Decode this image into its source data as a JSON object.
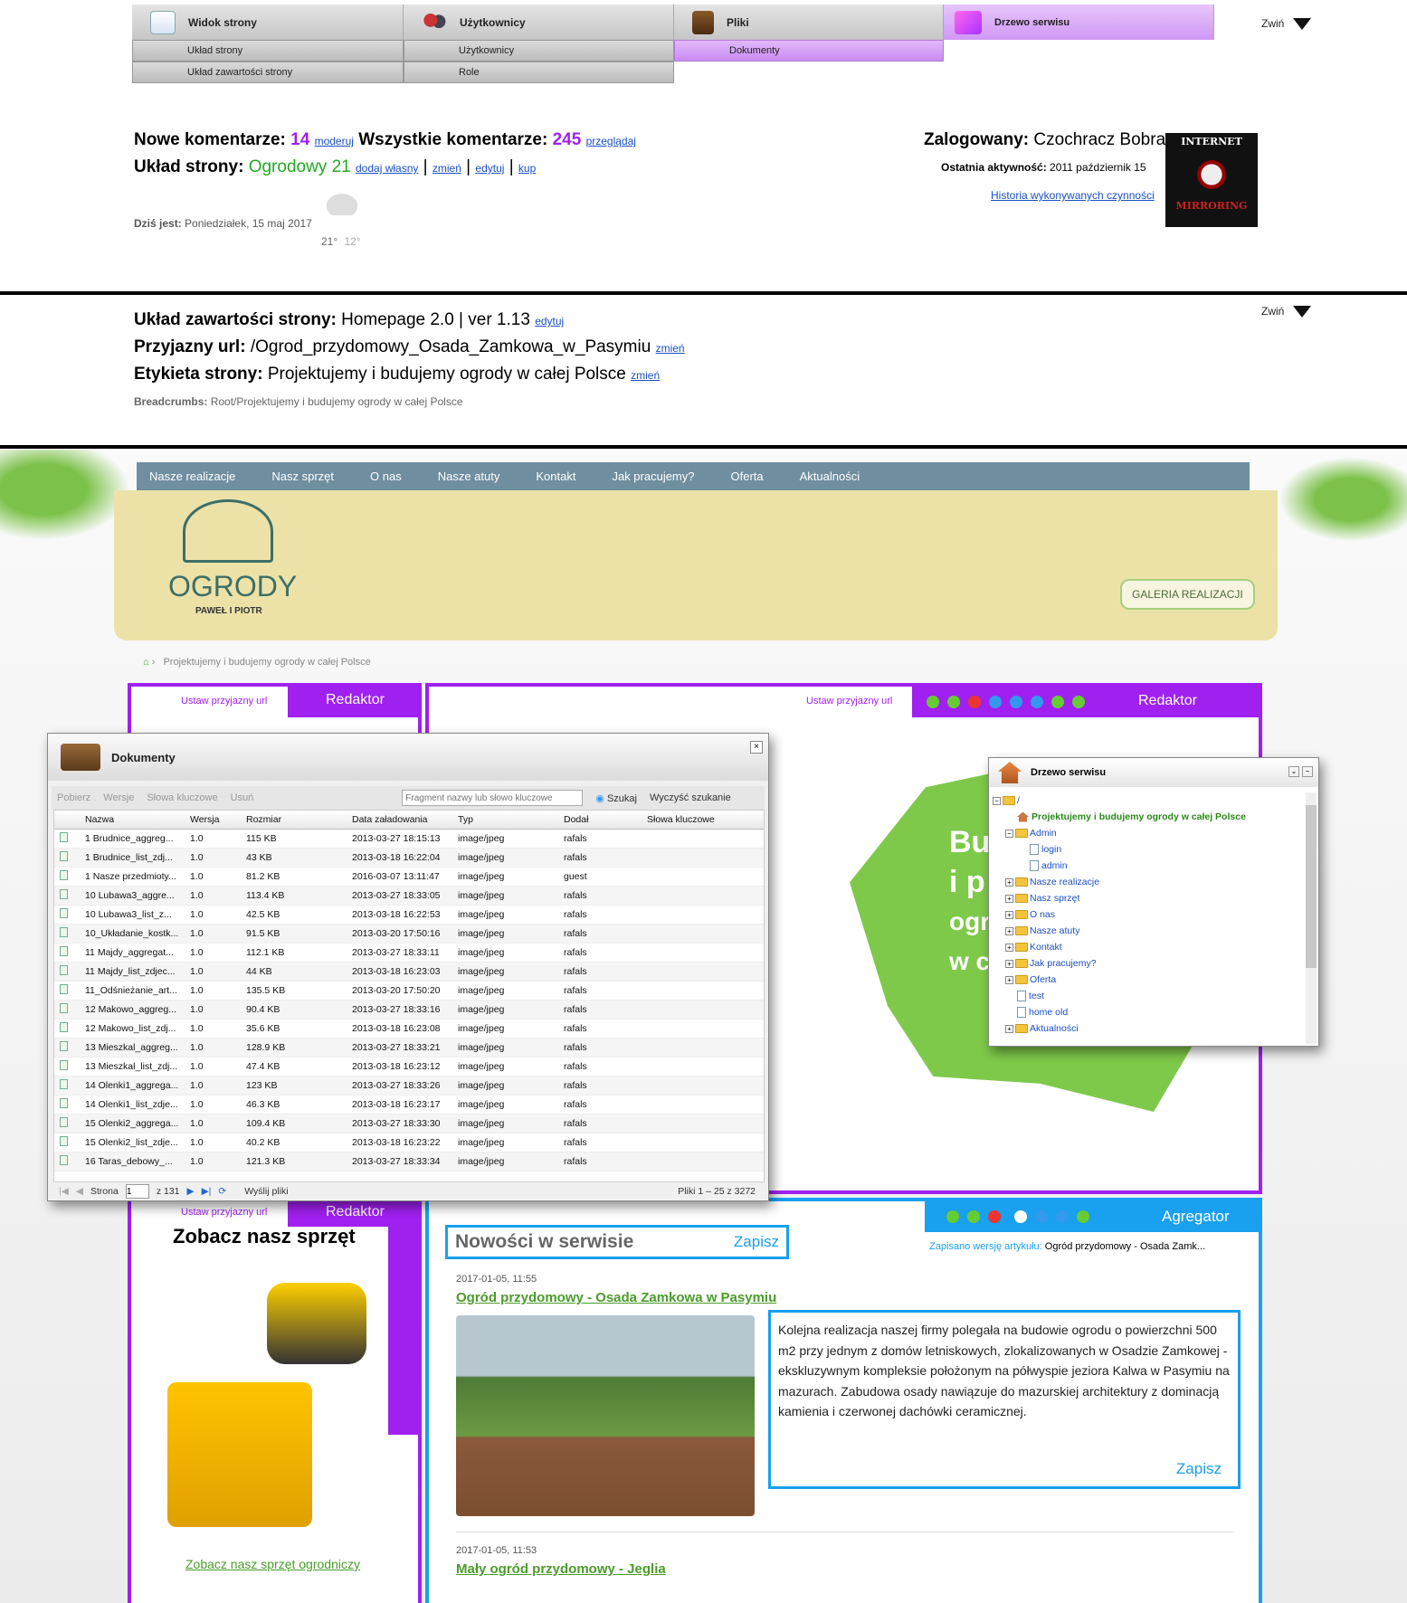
{
  "top_menu": {
    "tabs": [
      {
        "label": "Widok strony",
        "icon": "page-view-icon",
        "sub": [
          "Układ strony",
          "Układ zawartości strony"
        ]
      },
      {
        "label": "Użytkownicy",
        "icon": "users-icon",
        "sub": [
          "Użytkownicy",
          "Role"
        ]
      },
      {
        "label": "Pliki",
        "icon": "files-icon",
        "sub": [
          "Dokumenty"
        ]
      },
      {
        "label": "Drzewo serwisu",
        "icon": "site-tree-icon",
        "sub": []
      }
    ],
    "collapse_label": "Zwiń"
  },
  "info": {
    "new_comments_label": "Nowe komentarze:",
    "new_comments_count": "14",
    "moderate": "moderuj",
    "all_comments_label": "Wszystkie komentarze:",
    "all_comments_count": "245",
    "browse": "przeglądaj",
    "layout_label": "Układ strony:",
    "layout_value": "Ogrodowy 21",
    "add_own": "dodaj własny",
    "change": "zmień",
    "edit": "edytuj",
    "buy": "kup",
    "today_label": "Dziś jest:",
    "today_value": "Poniedziałek, 15 maj 2017",
    "temp_high": "21°",
    "temp_low": "12°",
    "logged_label": "Zalogowany:",
    "logged_user": "Czochracz Bobra",
    "last_activity_label": "Ostatnia aktywność:",
    "last_activity_value": "2011 październik 15",
    "history_link": "Historia wykonywanych czynności",
    "avatar_text_top": "INTERNET",
    "avatar_text_bottom": "MIRRORING"
  },
  "content_layout": {
    "layout_label": "Układ zawartości strony:",
    "layout_value": "Homepage 2.0 | ver 1.13",
    "edit": "edytuj",
    "url_label": "Przyjazny url:",
    "url_value": "/Ogrod_przydomowy_Osada_Zamkowa_w_Pasymiu",
    "url_change": "zmień",
    "tag_label": "Etykieta strony:",
    "tag_value": "Projektujemy i budujemy ogrody w całej Polsce",
    "tag_change": "zmień",
    "breadcrumbs_label": "Breadcrumbs:",
    "breadcrumbs_value": "Root/Projektujemy i budujemy ogrody w całej Polsce",
    "collapse_label": "Zwiń"
  },
  "site": {
    "nav": [
      "Nasze realizacje",
      "Nasz sprzęt",
      "O nas",
      "Nasze atuty",
      "Kontakt",
      "Jak pracujemy?",
      "Oferta",
      "Aktualności"
    ],
    "logo_title": "OGRODY",
    "logo_sub": "PAWEŁ I PIOTR",
    "gallery_button": "GALERIA REALIZACJI",
    "breadcrumb": "Projektujemy i budujemy ogrody w całej Polsce",
    "set_url": "Ustaw przyjazny url",
    "editor": "Redaktor",
    "aggregator": "Agregator",
    "map_text": [
      "Bu",
      "i p",
      "ogr",
      "w c"
    ],
    "equipment_title": "Zobacz nasz sprzęt",
    "equipment_link": "Zobacz nasz sprzęt ogrodniczy",
    "news_title": "Nowości w serwisie",
    "save": "Zapisz",
    "saved_version": "Zapisano wersję artykułu:",
    "saved_version_value": "Ogród przydomowy - Osada Zamk...",
    "news": [
      {
        "date": "2017-01-05, 11:55",
        "title": "Ogród przydomowy - Osada Zamkowa w Pasymiu",
        "text": "Kolejna realizacja naszej firmy polegała na budowie ogrodu o powierzchni 500 m2 przy jednym z domów letniskowych, zlokalizowanych w Osadzie Zamkowej - ekskluzywnym kompleksie położonym na półwyspie jeziora Kalwa w Pasymiu na mazurach. Zabudowa osady nawiązuje do mazurskiej architektury z dominacją kamienia i czerwonej dachówki ceramicznej."
      },
      {
        "date": "2017-01-05, 11:53",
        "title": "Mały ogród przydomowy - Jeglia"
      }
    ]
  },
  "documents": {
    "title": "Dokumenty",
    "toolbar": {
      "download": "Pobierz",
      "versions": "Wersje",
      "keywords": "Słowa kluczowe",
      "delete": "Usuń",
      "search_placeholder": "Fragment nazwy lub słowo kluczowe",
      "search": "Szukaj",
      "clear": "Wyczyść szukanie"
    },
    "columns": [
      "Nazwa",
      "Wersja",
      "Rozmiar",
      "Data załadowania",
      "Typ",
      "Dodał",
      "Słowa kluczowe"
    ],
    "rows": [
      [
        "1 Brudnice_aggreg...",
        "1.0",
        "115 KB",
        "2013-03-27 18:15:13",
        "image/jpeg",
        "rafals"
      ],
      [
        "1 Brudnice_list_zdj...",
        "1.0",
        "43 KB",
        "2013-03-18 16:22:04",
        "image/jpeg",
        "rafals"
      ],
      [
        "1 Nasze przedmioty...",
        "1.0",
        "81.2 KB",
        "2016-03-07 13:11:47",
        "image/jpeg",
        "guest"
      ],
      [
        "10 Lubawa3_aggre...",
        "1.0",
        "113.4 KB",
        "2013-03-27 18:33:05",
        "image/jpeg",
        "rafals"
      ],
      [
        "10 Lubawa3_list_z...",
        "1.0",
        "42.5 KB",
        "2013-03-18 16:22:53",
        "image/jpeg",
        "rafals"
      ],
      [
        "10_Układanie_kostk...",
        "1.0",
        "91.5 KB",
        "2013-03-20 17:50:16",
        "image/jpeg",
        "rafals"
      ],
      [
        "11 Majdy_aggregat...",
        "1.0",
        "112.1 KB",
        "2013-03-27 18:33:11",
        "image/jpeg",
        "rafals"
      ],
      [
        "11 Majdy_list_zdjec...",
        "1.0",
        "44 KB",
        "2013-03-18 16:23:03",
        "image/jpeg",
        "rafals"
      ],
      [
        "11_Odśnieżanie_art...",
        "1.0",
        "135.5 KB",
        "2013-03-20 17:50:20",
        "image/jpeg",
        "rafals"
      ],
      [
        "12 Makowo_aggreg...",
        "1.0",
        "90.4 KB",
        "2013-03-27 18:33:16",
        "image/jpeg",
        "rafals"
      ],
      [
        "12 Makowo_list_zdj...",
        "1.0",
        "35.6 KB",
        "2013-03-18 16:23:08",
        "image/jpeg",
        "rafals"
      ],
      [
        "13 Mieszkal_aggreg...",
        "1.0",
        "128.9 KB",
        "2013-03-27 18:33:21",
        "image/jpeg",
        "rafals"
      ],
      [
        "13 Mieszkal_list_zdj...",
        "1.0",
        "47.4 KB",
        "2013-03-18 16:23:12",
        "image/jpeg",
        "rafals"
      ],
      [
        "14 Olenki1_aggrega...",
        "1.0",
        "123 KB",
        "2013-03-27 18:33:26",
        "image/jpeg",
        "rafals"
      ],
      [
        "14 Olenki1_list_zdje...",
        "1.0",
        "46.3 KB",
        "2013-03-18 16:23:17",
        "image/jpeg",
        "rafals"
      ],
      [
        "15 Olenki2_aggrega...",
        "1.0",
        "109.4 KB",
        "2013-03-27 18:33:30",
        "image/jpeg",
        "rafals"
      ],
      [
        "15 Olenki2_list_zdje...",
        "1.0",
        "40.2 KB",
        "2013-03-18 16:23:22",
        "image/jpeg",
        "rafals"
      ],
      [
        "16 Taras_debowy_...",
        "1.0",
        "121.3 KB",
        "2013-03-27 18:33:34",
        "image/jpeg",
        "rafals"
      ]
    ],
    "pager": {
      "page_label": "Strona",
      "page_value": "1",
      "of": "z 131",
      "send": "Wyślij pliki",
      "summary": "Pliki 1 – 25 z 3272"
    }
  },
  "site_tree": {
    "title": "Drzewo serwisu",
    "items": [
      {
        "label": "/",
        "level": 0,
        "kind": "folder",
        "pm": "−"
      },
      {
        "label": "Projektujemy i budujemy ogrody w całej Polsce",
        "level": 1,
        "kind": "home",
        "pm": ""
      },
      {
        "label": "Admin",
        "level": 1,
        "kind": "folder",
        "pm": "−"
      },
      {
        "label": "login",
        "level": 2,
        "kind": "page",
        "pm": ""
      },
      {
        "label": "admin",
        "level": 2,
        "kind": "page",
        "pm": ""
      },
      {
        "label": "Nasze realizacje",
        "level": 1,
        "kind": "folder",
        "pm": "+"
      },
      {
        "label": "Nasz sprzęt",
        "level": 1,
        "kind": "folder",
        "pm": "+"
      },
      {
        "label": "O nas",
        "level": 1,
        "kind": "folder",
        "pm": "+"
      },
      {
        "label": "Nasze atuty",
        "level": 1,
        "kind": "folder",
        "pm": "+"
      },
      {
        "label": "Kontakt",
        "level": 1,
        "kind": "folder",
        "pm": "+"
      },
      {
        "label": "Jak pracujemy?",
        "level": 1,
        "kind": "folder",
        "pm": "+"
      },
      {
        "label": "Oferta",
        "level": 1,
        "kind": "folder",
        "pm": "+"
      },
      {
        "label": "test",
        "level": 1,
        "kind": "page",
        "pm": ""
      },
      {
        "label": "home old",
        "level": 1,
        "kind": "page",
        "pm": ""
      },
      {
        "label": "Aktualności",
        "level": 1,
        "kind": "folder",
        "pm": "+"
      }
    ]
  }
}
